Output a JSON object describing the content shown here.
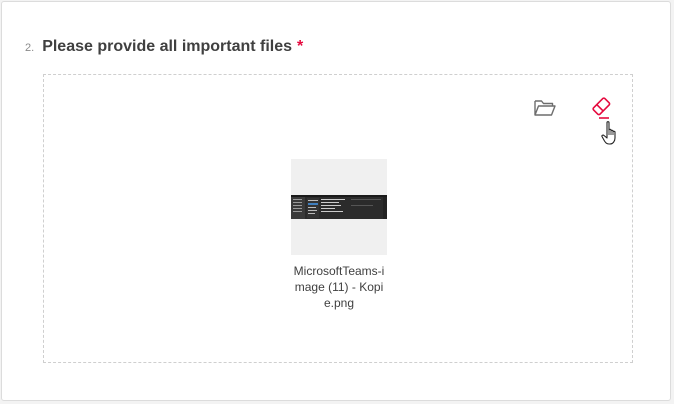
{
  "question": {
    "number": "2.",
    "title": "Please provide all important files",
    "required_marker": "*"
  },
  "toolbar": {
    "open_icon": "folder-open-icon",
    "clear_icon": "eraser-icon"
  },
  "files": [
    {
      "name": "MicrosoftTeams-image (11) - Kopie.png",
      "thumbnail": "screenshot-thumbnail"
    }
  ],
  "colors": {
    "required": "#e50a3e",
    "accent": "#e50a3e",
    "icon_gray": "#6d6d6d",
    "text": "#404040"
  }
}
